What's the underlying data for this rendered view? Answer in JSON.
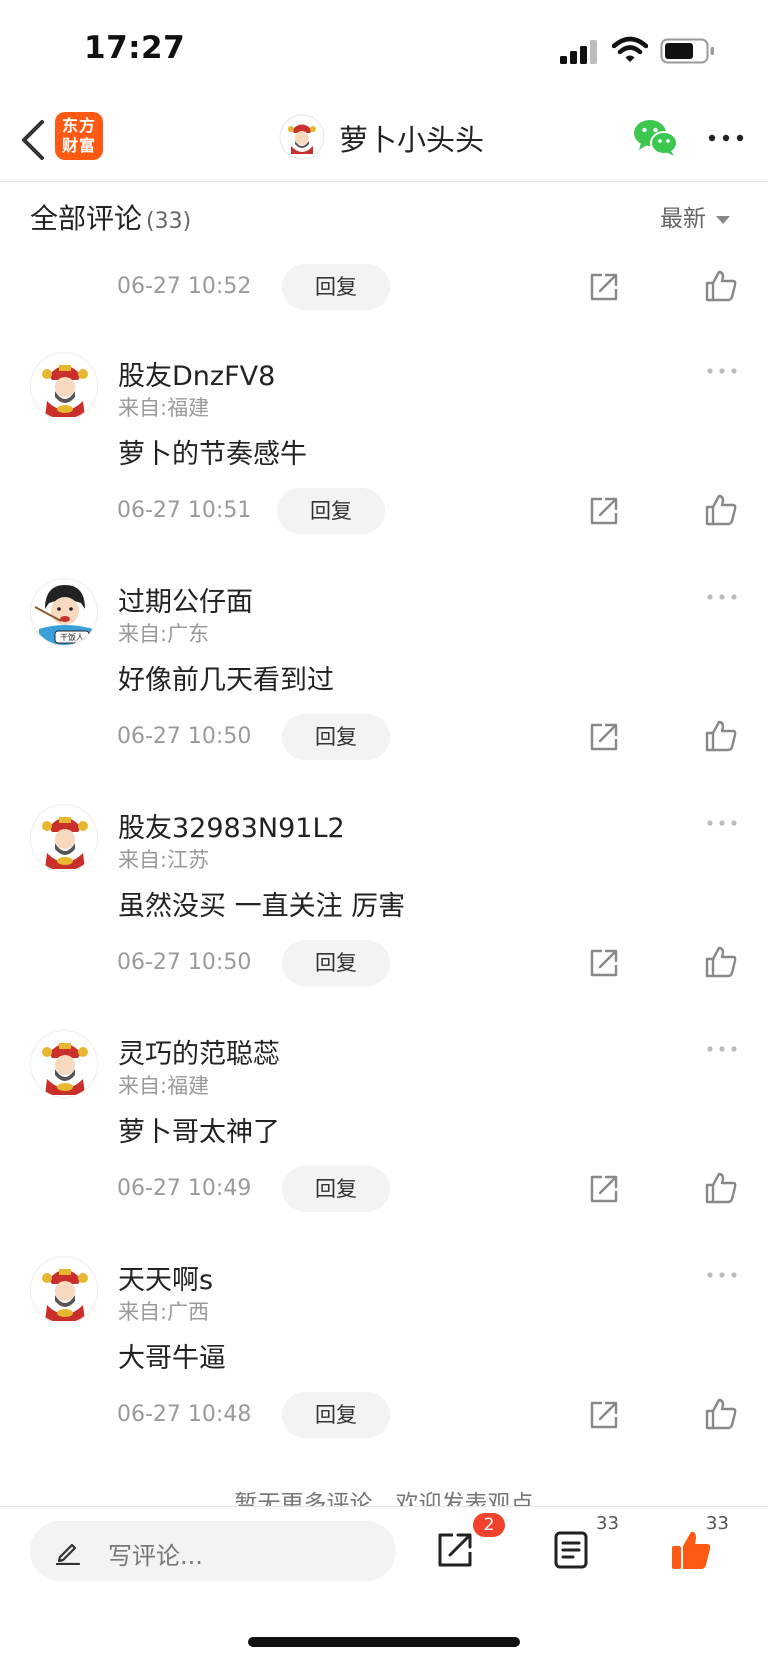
{
  "status_bar": {
    "time": "17:27"
  },
  "nav": {
    "logo_line1": "东方",
    "logo_line2": "财富",
    "title": "萝卜小头头"
  },
  "section": {
    "title": "全部评论",
    "count": "(33)",
    "sort_label": "最新"
  },
  "top_partial": {
    "timestamp": "06-27 10:52",
    "reply_label": "回复"
  },
  "comments": [
    {
      "username": "股友DnzFV8",
      "location": "来自:福建",
      "text": "萝卜的节奏感牛",
      "timestamp": "06-27 10:51",
      "reply_label": "回复",
      "avatar": "caishen-avatar"
    },
    {
      "username": "过期公仔面",
      "location": "来自:广东",
      "text": "好像前几天看到过",
      "timestamp": "06-27 10:50",
      "reply_label": "回复",
      "avatar": "ganfan-avatar",
      "avatar_caption": "干饭人"
    },
    {
      "username": "股友32983N91L2",
      "location": "来自:江苏",
      "text": "虽然没买 一直关注 厉害",
      "timestamp": "06-27 10:50",
      "reply_label": "回复",
      "avatar": "caishen-avatar"
    },
    {
      "username": "灵巧的范聪蕊",
      "location": "来自:福建",
      "text": "萝卜哥太神了",
      "timestamp": "06-27 10:49",
      "reply_label": "回复",
      "avatar": "caishen-avatar"
    },
    {
      "username": "天天啊s",
      "location": "来自:广西",
      "text": "大哥牛逼",
      "timestamp": "06-27 10:48",
      "reply_label": "回复",
      "avatar": "caishen-avatar"
    }
  ],
  "footer_note": "暂无更多评论，欢迎发表观点",
  "toolbar": {
    "comment_placeholder": "写评论...",
    "share_badge": "2",
    "list_count": "33",
    "like_count": "33"
  },
  "colors": {
    "brand_orange": "#ff5a14",
    "wechat_green": "#3cc850",
    "badge_red": "#f0422c"
  }
}
